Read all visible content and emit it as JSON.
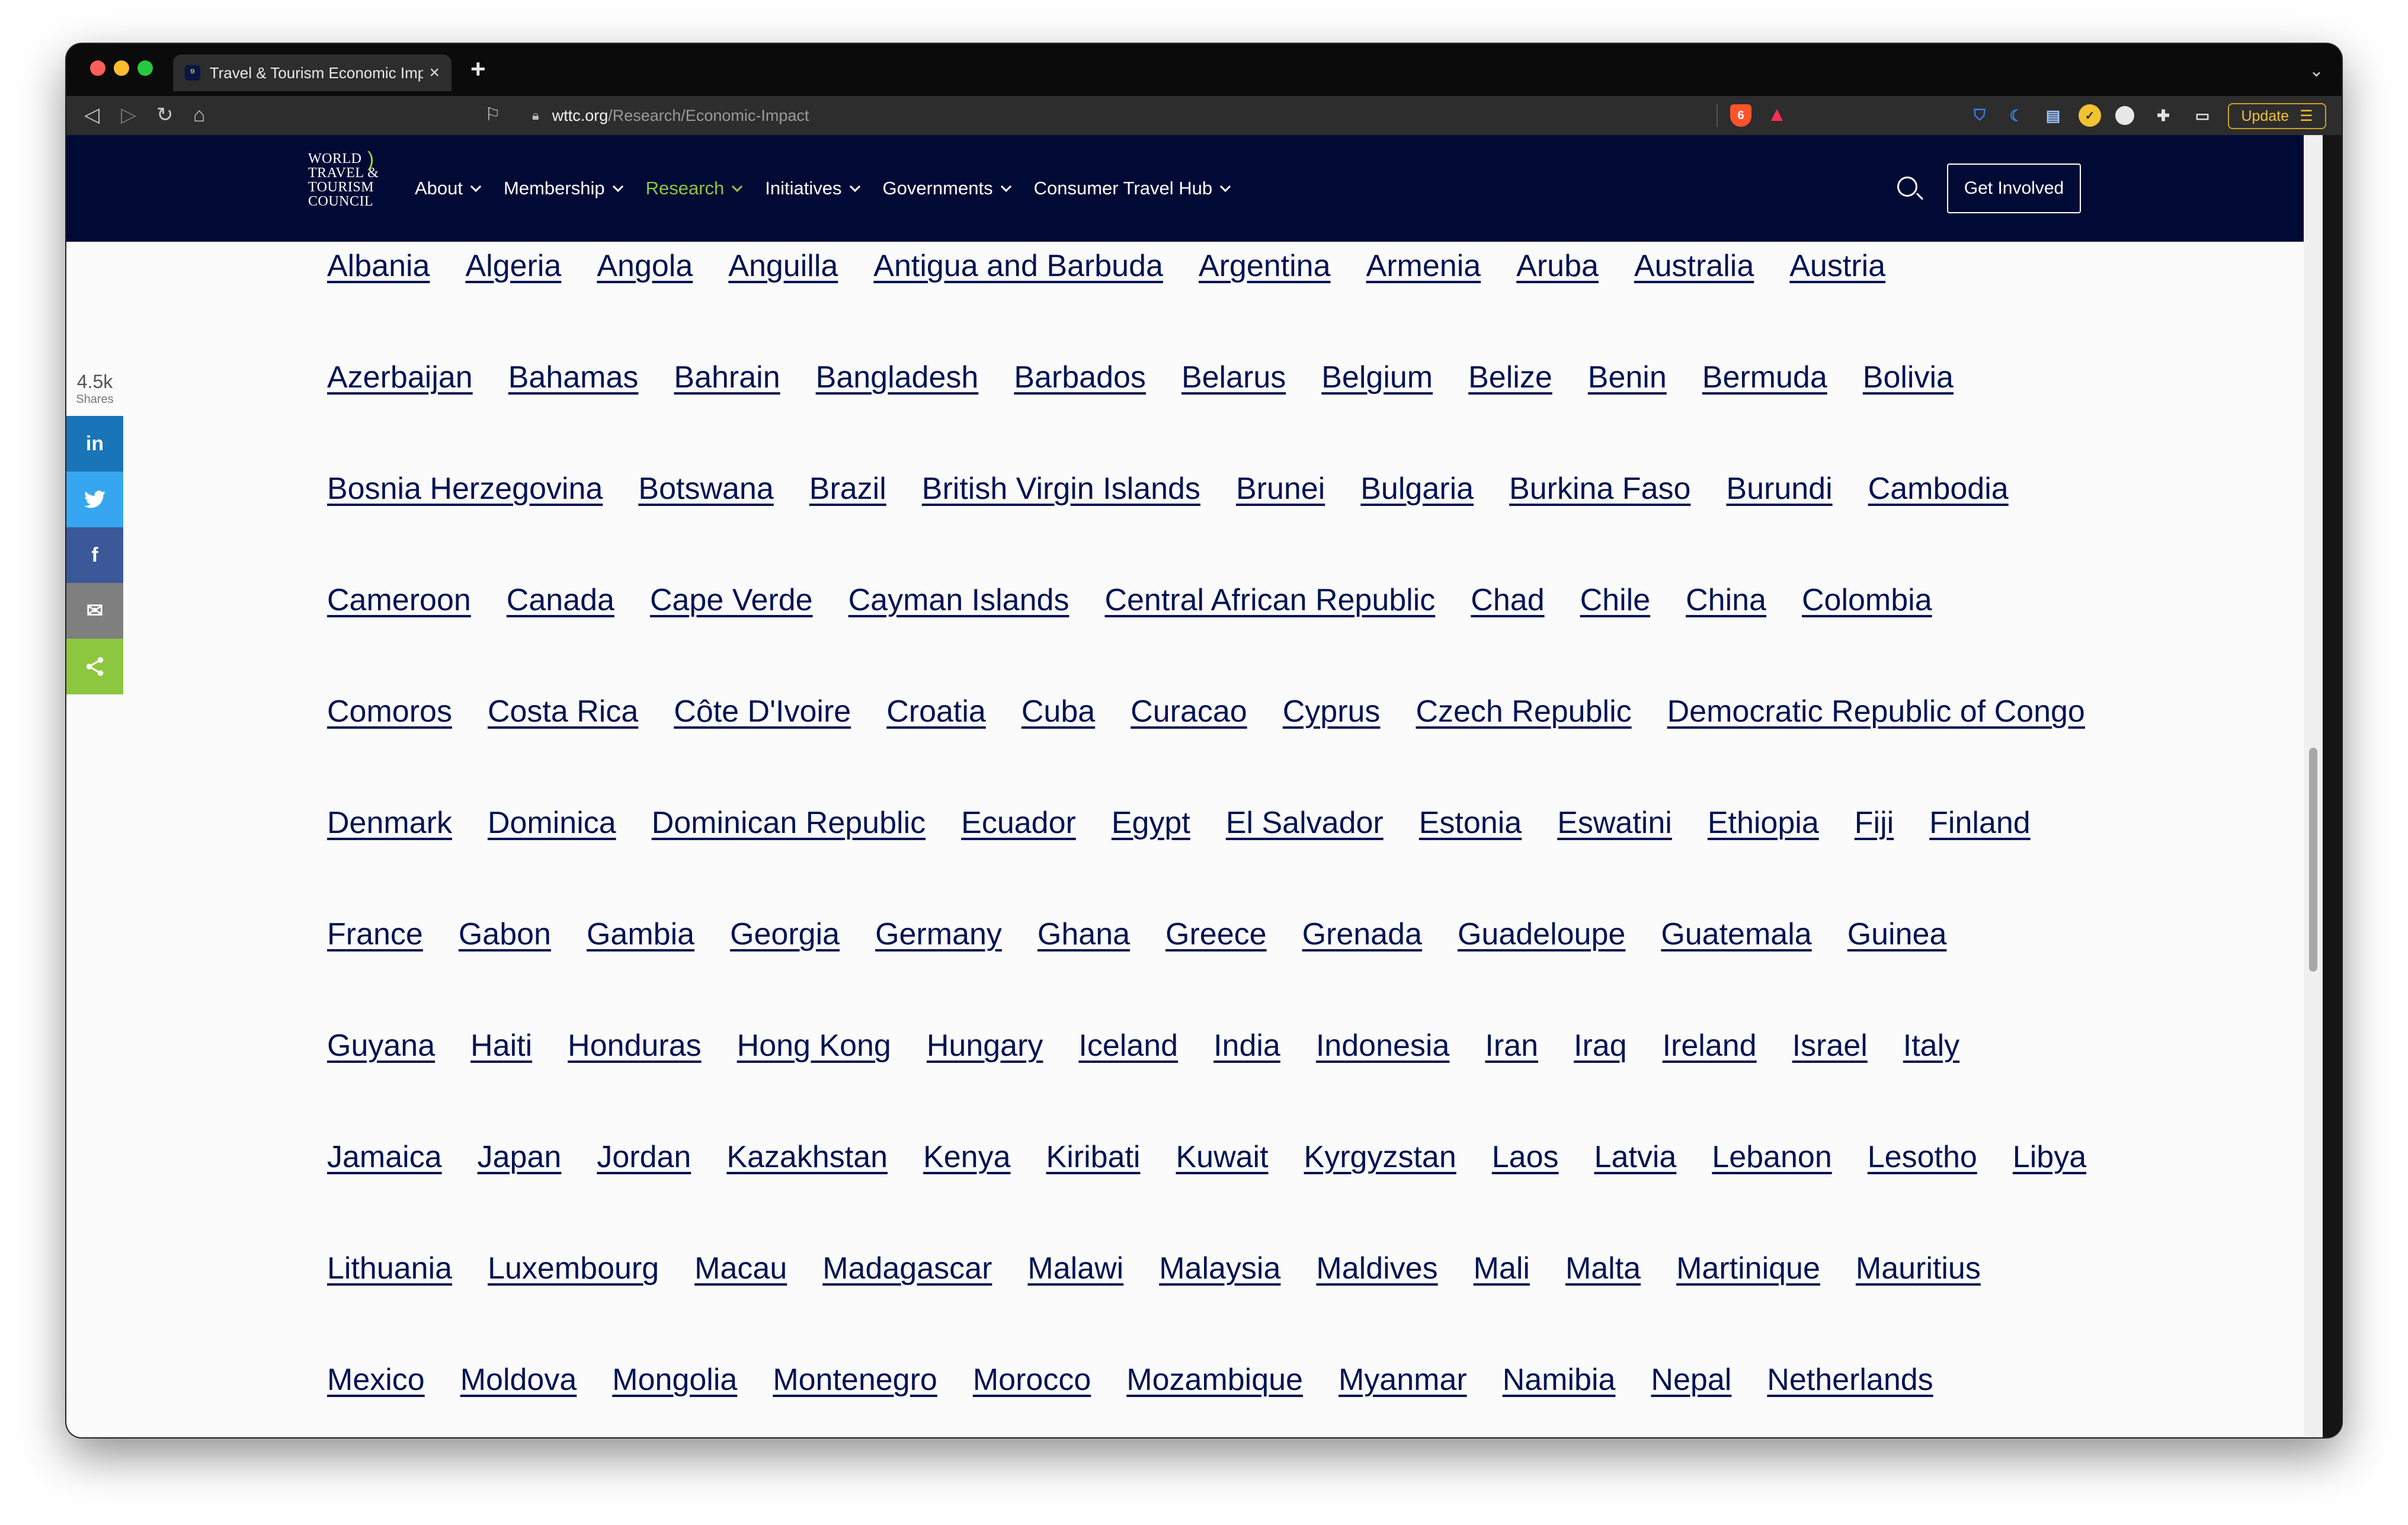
{
  "browser": {
    "tab_title": "Travel & Tourism Economic Impact",
    "tab_favicon_glyph": "⁹",
    "new_tab_label": "+",
    "url_host": "wttc.org",
    "url_path": "/Research/Economic-Impact",
    "brave_shield_count": "6",
    "update_label": "Update"
  },
  "site": {
    "logo_lines": [
      "WORLD",
      "TRAVEL &",
      "TOURISM",
      "COUNCIL"
    ],
    "nav": [
      {
        "label": "About",
        "active": false
      },
      {
        "label": "Membership",
        "active": false
      },
      {
        "label": "Research",
        "active": true
      },
      {
        "label": "Initiatives",
        "active": false
      },
      {
        "label": "Governments",
        "active": false
      },
      {
        "label": "Consumer Travel Hub",
        "active": false
      }
    ],
    "get_involved_label": "Get Involved",
    "accent_color": "#8cc63f",
    "header_color": "#010a35"
  },
  "share": {
    "count": "4.5k",
    "label": "Shares"
  },
  "countries": [
    [
      "Albania",
      "Algeria",
      "Angola",
      "Anguilla",
      "Antigua and Barbuda",
      "Argentina",
      "Armenia",
      "Aruba",
      "Australia",
      "Austria"
    ],
    [
      "Azerbaijan",
      "Bahamas",
      "Bahrain",
      "Bangladesh",
      "Barbados",
      "Belarus",
      "Belgium",
      "Belize",
      "Benin",
      "Bermuda",
      "Bolivia"
    ],
    [
      "Bosnia Herzegovina",
      "Botswana",
      "Brazil",
      "British Virgin Islands",
      "Brunei",
      "Bulgaria",
      "Burkina Faso",
      "Burundi",
      "Cambodia"
    ],
    [
      "Cameroon",
      "Canada",
      "Cape Verde",
      "Cayman Islands",
      "Central African Republic",
      "Chad",
      "Chile",
      "China",
      "Colombia"
    ],
    [
      "Comoros",
      "Costa Rica",
      "Côte D'Ivoire",
      "Croatia",
      "Cuba",
      "Curacao",
      "Cyprus",
      "Czech Republic",
      "Democratic Republic of Congo"
    ],
    [
      "Denmark",
      "Dominica",
      "Dominican Republic",
      "Ecuador",
      "Egypt",
      "El Salvador",
      "Estonia",
      "Eswatini",
      "Ethiopia",
      "Fiji",
      "Finland"
    ],
    [
      "France",
      "Gabon",
      "Gambia",
      "Georgia",
      "Germany",
      "Ghana",
      "Greece",
      "Grenada",
      "Guadeloupe",
      "Guatemala",
      "Guinea"
    ],
    [
      "Guyana",
      "Haiti",
      "Honduras",
      "Hong Kong",
      "Hungary",
      "Iceland",
      "India",
      "Indonesia",
      "Iran",
      "Iraq",
      "Ireland",
      "Israel",
      "Italy"
    ],
    [
      "Jamaica",
      "Japan",
      "Jordan",
      "Kazakhstan",
      "Kenya",
      "Kiribati",
      "Kuwait",
      "Kyrgyzstan",
      "Laos",
      "Latvia",
      "Lebanon",
      "Lesotho",
      "Libya"
    ],
    [
      "Lithuania",
      "Luxembourg",
      "Macau",
      "Madagascar",
      "Malawi",
      "Malaysia",
      "Maldives",
      "Mali",
      "Malta",
      "Martinique",
      "Mauritius"
    ],
    [
      "Mexico",
      "Moldova",
      "Mongolia",
      "Montenegro",
      "Morocco",
      "Mozambique",
      "Myanmar",
      "Namibia",
      "Nepal",
      "Netherlands"
    ]
  ]
}
